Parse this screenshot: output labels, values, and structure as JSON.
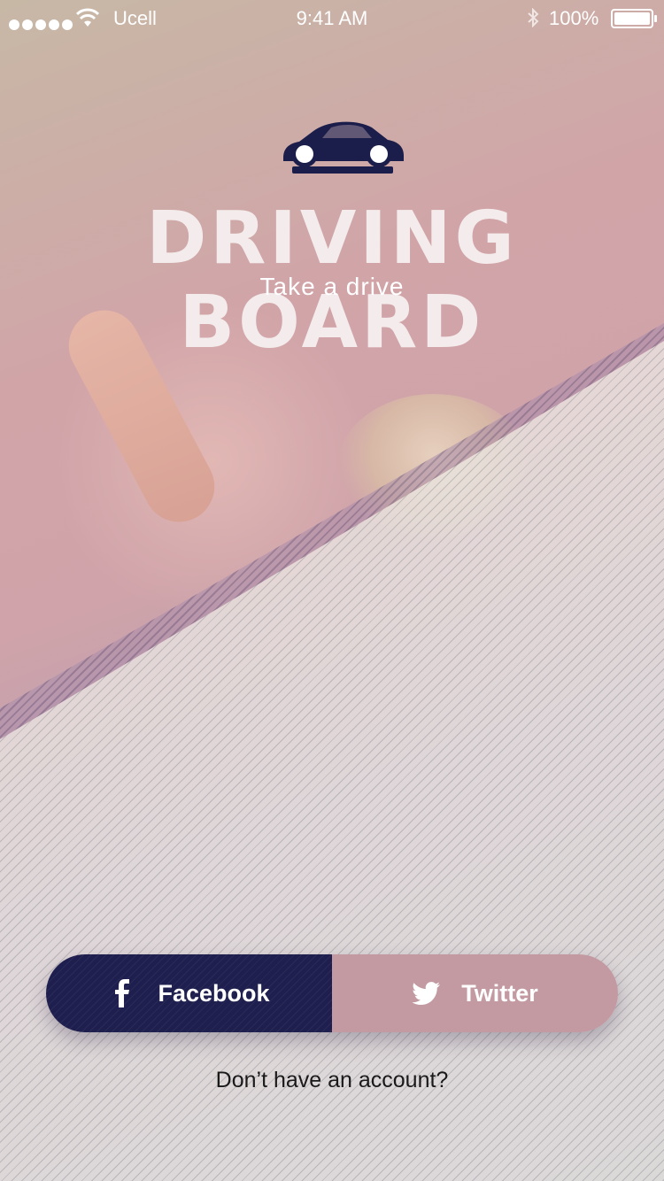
{
  "status_bar": {
    "carrier": "Ucell",
    "time": "9:41 AM",
    "battery": "100%"
  },
  "brand": {
    "title": "DRIVING BOARD",
    "subtitle": "Take a drive",
    "logo_icon": "car-icon",
    "title_color": "#f4ecec"
  },
  "social": {
    "facebook_label": "Facebook",
    "facebook_icon": "facebook-icon",
    "facebook_color": "#1e1f4e",
    "twitter_label": "Twitter",
    "twitter_icon": "twitter-icon",
    "twitter_color": "#c39aa2"
  },
  "signup": {
    "text": "Don’t have an account?"
  }
}
